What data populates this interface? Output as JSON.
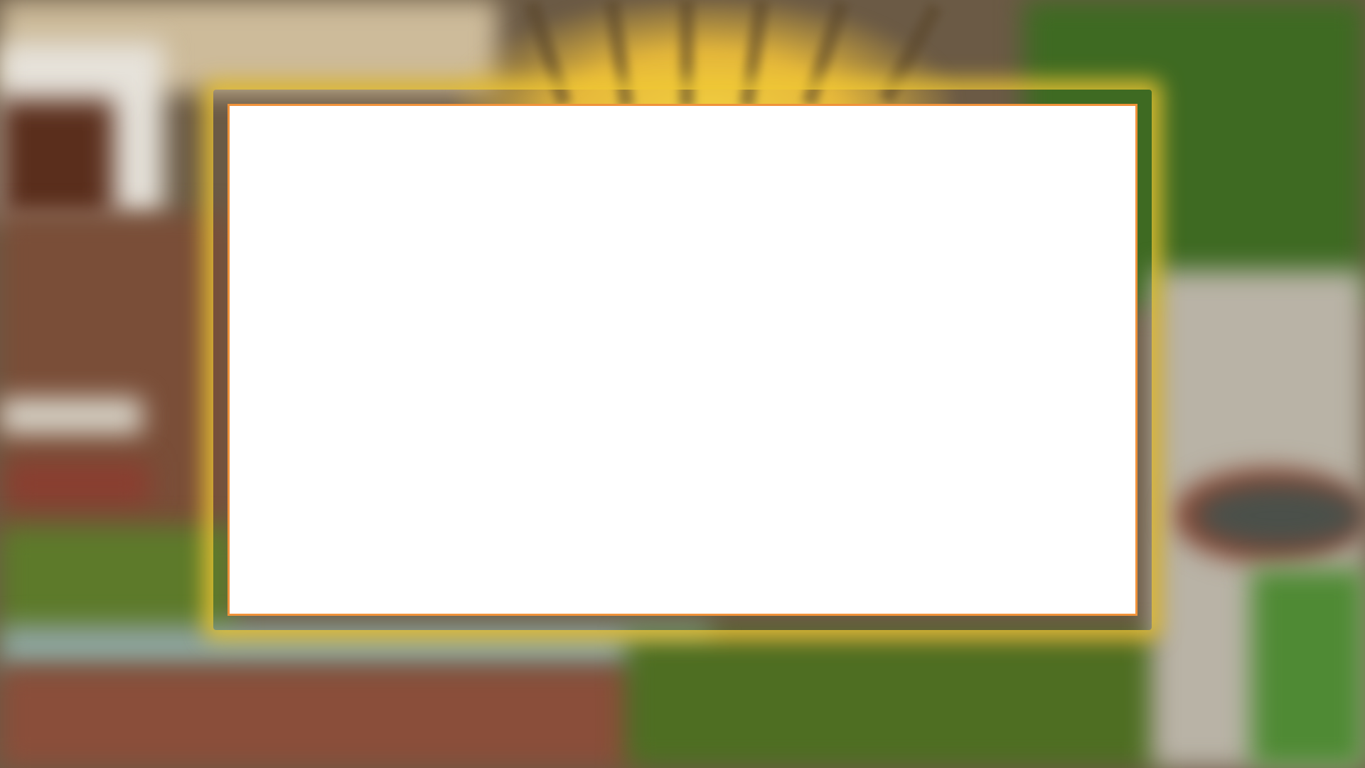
{
  "colors": {
    "panel_background": "#ffffff",
    "panel_border": "#f0923a",
    "glow": "#f2d040"
  }
}
